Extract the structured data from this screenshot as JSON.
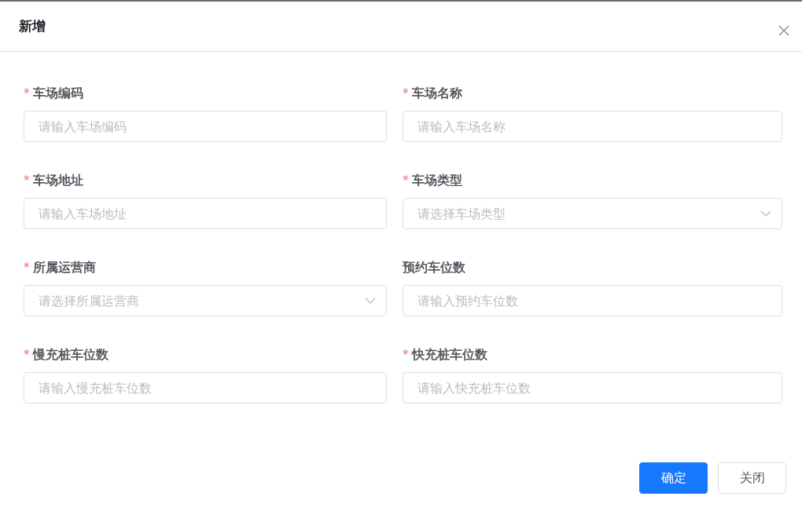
{
  "dialog": {
    "title": "新增",
    "footer": {
      "buttons": [
        {
          "label": "确定",
          "kind": "primary"
        },
        {
          "label": "关闭",
          "kind": "default"
        }
      ]
    }
  },
  "fields": [
    {
      "label": "车场编码",
      "required_mark": "*",
      "kind": "input",
      "placeholder": "请输入车场编码"
    },
    {
      "label": "车场名称",
      "required_mark": "*",
      "kind": "input",
      "placeholder": "请输入车场名称"
    },
    {
      "label": "车场地址",
      "required_mark": "*",
      "kind": "input",
      "placeholder": "请输入车场地址"
    },
    {
      "label": "车场类型",
      "required_mark": "*",
      "kind": "select",
      "placeholder": "请选择车场类型"
    },
    {
      "label": "所属运营商",
      "required_mark": "*",
      "kind": "select",
      "placeholder": "请选择所属运营商"
    },
    {
      "label": "预约车位数",
      "kind": "input",
      "placeholder": "请输入预约车位数"
    },
    {
      "label": "慢充桩车位数",
      "required_mark": "*",
      "kind": "input",
      "placeholder": "请输入慢充桩车位数"
    },
    {
      "label": "快充桩车位数",
      "required_mark": "*",
      "kind": "input",
      "placeholder": "请输入快充桩车位数"
    }
  ]
}
